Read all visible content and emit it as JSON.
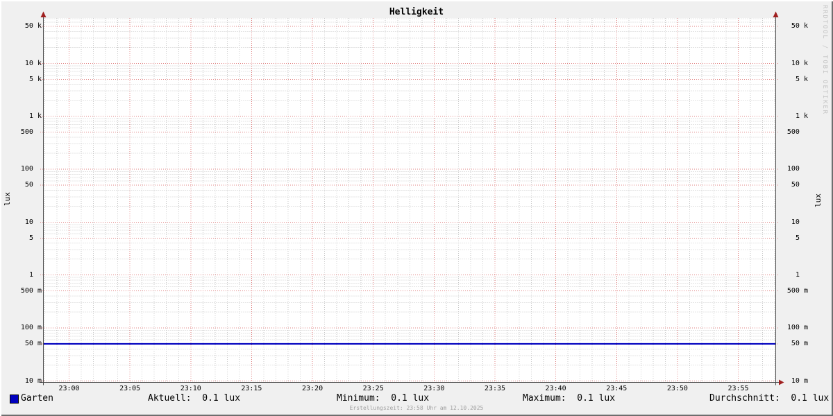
{
  "title": "Helligkeit",
  "watermark": "RRDTOOL / TOBI OETIKER",
  "footer": "Erstellungszeit: 23:58 Uhr am 12.10.2025",
  "legend": {
    "series_label": "Garten",
    "stats": [
      {
        "label": "Aktuell:",
        "value": "0.1 lux",
        "display": "Aktuell:  0.1 lux"
      },
      {
        "label": "Minimum:",
        "value": "0.1 lux",
        "display": "Minimum:  0.1 lux"
      },
      {
        "label": "Maximum:",
        "value": "0.1 lux",
        "display": "Maximum:  0.1 lux"
      },
      {
        "label": "Durchschnitt:",
        "value": "0.1 lux",
        "display": "Durchschnitt:  0.1 lux"
      }
    ]
  },
  "colors": {
    "background": "#f0f0f0",
    "canvas": "#ffffff",
    "grid_major": "#e08080",
    "grid_minor": "#c9c9c9",
    "axis": "#4a4a4a",
    "arrow": "#a02020",
    "series": "#0000bf",
    "watermark_text": "#c5c5c5",
    "footer_text": "#a0a0a0",
    "text": "#000000"
  },
  "chart_data": {
    "type": "line",
    "title": "Helligkeit",
    "ylabel": "lux",
    "ylabel_right": "lux",
    "y_scale": "log",
    "ylim": [
      0.01,
      70000
    ],
    "y_major_ticks": [
      {
        "value": 50000,
        "label": "50 k"
      },
      {
        "value": 10000,
        "label": "10 k"
      },
      {
        "value": 5000,
        "label": "5 k"
      },
      {
        "value": 1000,
        "label": "1 k"
      },
      {
        "value": 500,
        "label": "500"
      },
      {
        "value": 100,
        "label": "100"
      },
      {
        "value": 50,
        "label": "50"
      },
      {
        "value": 10,
        "label": "10"
      },
      {
        "value": 5,
        "label": "5"
      },
      {
        "value": 1,
        "label": "1"
      },
      {
        "value": 0.5,
        "label": "500 m"
      },
      {
        "value": 0.1,
        "label": "100 m"
      },
      {
        "value": 0.05,
        "label": "50 m"
      },
      {
        "value": 0.01,
        "label": "10 m"
      }
    ],
    "x_tick_labels": [
      "23:00",
      "23:05",
      "23:10",
      "23:15",
      "23:20",
      "23:25",
      "23:30",
      "23:35",
      "23:40",
      "23:45",
      "23:50",
      "23:55"
    ],
    "x_range_minutes": [
      -2.1,
      58.1
    ],
    "x_minor_step_minutes": 1,
    "x_major_step_minutes": 5,
    "series": [
      {
        "name": "Garten",
        "color": "#0000bf",
        "constant_value": 0.05
      }
    ],
    "stats": {
      "Aktuell": "0.1 lux",
      "Minimum": "0.1 lux",
      "Maximum": "0.1 lux",
      "Durchschnitt": "0.1 lux"
    },
    "legend_position": "bottom",
    "grid": "log-dotted"
  }
}
